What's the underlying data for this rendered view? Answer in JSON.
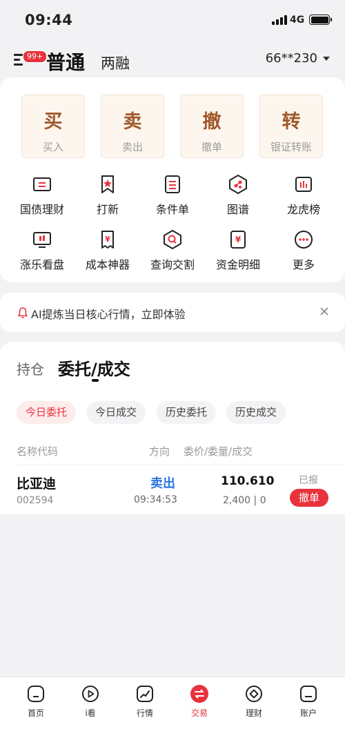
{
  "status_bar": {
    "time": "09:44",
    "network": "4G"
  },
  "header": {
    "badge": "99+",
    "tab_normal": "普通",
    "tab_margin": "两融",
    "account": "66**230"
  },
  "quick_actions": [
    {
      "big": "买",
      "small": "买入"
    },
    {
      "big": "卖",
      "small": "卖出"
    },
    {
      "big": "撤",
      "small": "撤单"
    },
    {
      "big": "转",
      "small": "银证转账"
    }
  ],
  "grid_row1": [
    {
      "label": "国债理财",
      "icon": "bond-icon"
    },
    {
      "label": "打新",
      "icon": "new-stock-icon"
    },
    {
      "label": "条件单",
      "icon": "conditional-order-icon"
    },
    {
      "label": "图谱",
      "icon": "graph-icon"
    },
    {
      "label": "龙虎榜",
      "icon": "ranking-icon"
    }
  ],
  "grid_row2": [
    {
      "label": "涨乐看盘",
      "icon": "market-watch-icon"
    },
    {
      "label": "成本神器",
      "icon": "cost-tool-icon"
    },
    {
      "label": "查询交割",
      "icon": "query-settlement-icon"
    },
    {
      "label": "资金明细",
      "icon": "funds-detail-icon"
    },
    {
      "label": "更多",
      "icon": "more-icon"
    }
  ],
  "ai_banner": {
    "text": "AI提炼当日核心行情，立即体验"
  },
  "orders": {
    "tab_hold": "持仓",
    "tab_entrust": "委托/成交",
    "chips": [
      "今日委托",
      "今日成交",
      "历史委托",
      "历史成交"
    ],
    "columns": {
      "name": "名称代码",
      "direction": "方向",
      "price_qty": "委价/委量/成交"
    },
    "rows": [
      {
        "name": "比亚迪",
        "code": "002594",
        "direction": "卖出",
        "time": "09:34:53",
        "price": "110.610",
        "qty": "2,400 | 0",
        "status": "已报",
        "action": "撤单"
      }
    ]
  },
  "bottom_nav": [
    {
      "label": "首页",
      "icon": "home-icon"
    },
    {
      "label": "i看",
      "icon": "play-icon"
    },
    {
      "label": "行情",
      "icon": "trend-icon"
    },
    {
      "label": "交易",
      "icon": "exchange-icon"
    },
    {
      "label": "理财",
      "icon": "wealth-icon"
    },
    {
      "label": "账户",
      "icon": "account-icon"
    }
  ],
  "colors": {
    "accent": "#e8323c",
    "buy_sell_text": "#a0582a",
    "direction_blue": "#2c74e0"
  }
}
